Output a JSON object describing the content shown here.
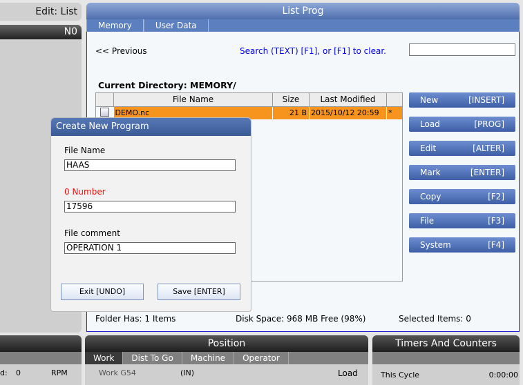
{
  "left": {
    "mode": "Edit: List",
    "program": "N0"
  },
  "main": {
    "title": "List Prog",
    "tabs": [
      "Memory",
      "User Data"
    ],
    "previous": "<< Previous",
    "search_hint": "Search (TEXT) [F1], or [F1] to clear.",
    "search_value": "",
    "current_directory": "Current Directory: MEMORY/",
    "table": {
      "headers": [
        "",
        "File Name",
        "Size",
        "Last Modified",
        ""
      ],
      "rows": [
        {
          "checked": false,
          "name": "DEMO.nc",
          "size": "21 B",
          "modified": "2015/10/12 20:59",
          "flag": "*"
        }
      ]
    },
    "buttons": [
      {
        "label": "New",
        "key": "[INSERT]"
      },
      {
        "label": "Load",
        "key": "[PROG]"
      },
      {
        "label": "Edit",
        "key": "[ALTER]"
      },
      {
        "label": "Mark",
        "key": "[ENTER]"
      },
      {
        "label": "Copy",
        "key": "[F2]"
      },
      {
        "label": "File",
        "key": "[F3]"
      },
      {
        "label": "System",
        "key": "[F4]"
      }
    ],
    "status": {
      "folder": "Folder Has: 1 Items",
      "disk": "Disk Space: 968 MB Free (98%)",
      "selected": "Selected Items: 0"
    }
  },
  "dialog": {
    "title": "Create New Program",
    "file_name_label": "File Name",
    "file_name": "HAAS",
    "number_label": "0 Number",
    "number": "17596",
    "comment_label": "File comment",
    "comment": "OPERATION 1",
    "exit": "Exit [UNDO]",
    "save": "Save [ENTER]"
  },
  "bottom": {
    "spindle_label": "d:",
    "spindle_value": "0",
    "spindle_unit": "RPM",
    "position": {
      "title": "Position",
      "tabs": [
        "Work",
        "Dist To Go",
        "Machine",
        "Operator"
      ],
      "coord": "Work G54",
      "unit": "(IN)",
      "load": "Load"
    },
    "timers": {
      "title": "Timers And Counters",
      "this_cycle": "This Cycle",
      "this_cycle_value": "0:00:00"
    }
  },
  "colors": {
    "accent": "#4f6fae",
    "selected_row": "#f7941d",
    "link": "#0000ee",
    "number_label": "#ee1111"
  }
}
